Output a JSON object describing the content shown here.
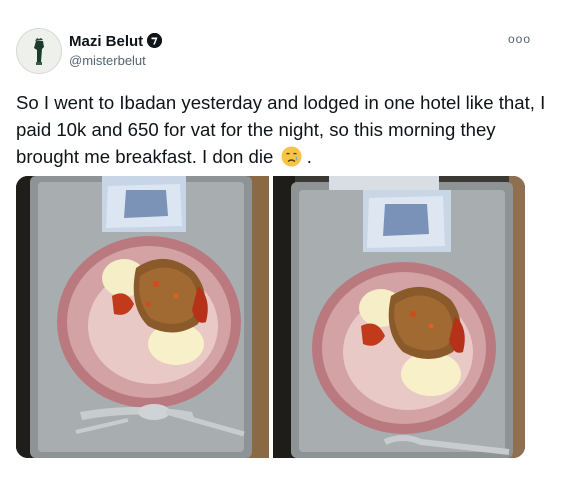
{
  "tweet": {
    "display_name": "Mazi Belut",
    "handle": "@misterbelut",
    "more_label": "ooo",
    "text": "So I went to Ibadan yesterday and lodged in one hotel like that, I paid 10k and 650 for vat for the night, so this morning they brought me breakfast.  I don die"
  },
  "icons": {
    "avatar": "avatar",
    "verified": "verified-badge-icon",
    "more": "more-options-icon",
    "emoji": "crying-face-emoji-icon"
  },
  "colors": {
    "text": "#0f1419",
    "secondary": "#536471",
    "plate": "#c6888c"
  }
}
